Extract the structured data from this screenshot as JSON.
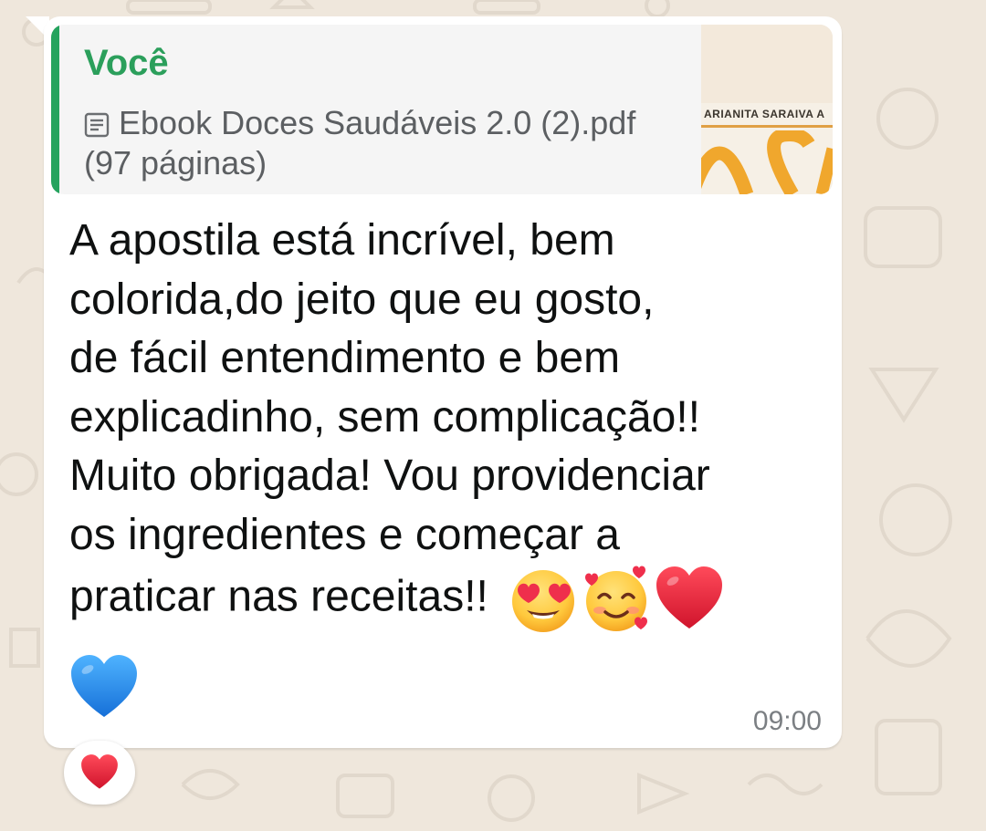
{
  "quoted": {
    "author": "Você",
    "file_name": "Ebook Doces Saudáveis 2.0 (2).pdf",
    "page_count": "(97 páginas)",
    "icon": "document-icon",
    "thumbnail_author": "ARIANITA SARAIVA A",
    "accent_color": "#25a35e"
  },
  "message": {
    "text": "A apostila está incrível, bem\ncolorida,do jeito que eu gosto,\nde fácil entendimento e bem\nexplicadinho, sem complicação!!\nMuito obrigada! Vou providenciar\nos ingredientes e começar a\npraticar nas receitas!!",
    "emojis": [
      "heart-eyes-emoji",
      "smiling-face-with-hearts-emoji",
      "red-heart-emoji",
      "blue-heart-emoji"
    ],
    "time": "09:00"
  },
  "reaction": {
    "emoji": "red-heart-emoji"
  }
}
